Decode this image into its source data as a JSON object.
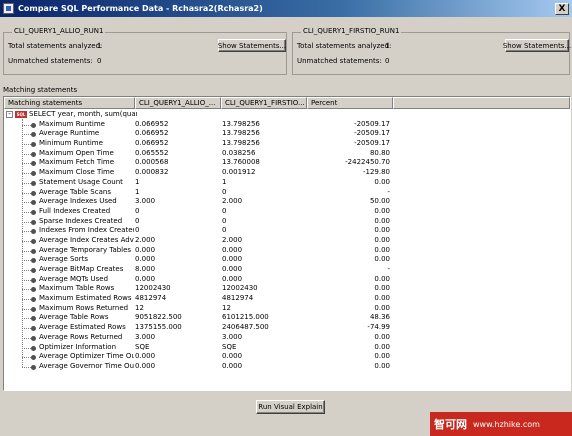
{
  "window": {
    "title": "Compare SQL Performance Data - Rchasra2(Rchasra2)",
    "close_glyph": "X"
  },
  "left_group": {
    "legend": "CLI_QUERY1_ALLIO_RUN1",
    "total_label": "Total statements analyzed:",
    "total_value": "1",
    "unmatched_label": "Unmatched statements:",
    "unmatched_value": "0",
    "button_label": "Show Statements..."
  },
  "right_group": {
    "legend": "CLI_QUERY1_FIRSTIO_RUN1",
    "total_label": "Total statements analyzed:",
    "total_value": "1",
    "unmatched_label": "Unmatched statements:",
    "unmatched_value": "0",
    "button_label": "Show Statements..."
  },
  "section_label": "Matching statements",
  "table": {
    "columns": [
      "Matching statements",
      "CLI_QUERY1_ALLIO_...",
      "CLI_QUERY1_FIRSTIO...",
      "Percent"
    ],
    "root": {
      "icon_text": "SQL",
      "expander": "-",
      "text": "SELECT year, month, sum(quantit"
    },
    "rows": [
      [
        "Maximum Runtime",
        "0.066952",
        "13.798256",
        "-20509.17"
      ],
      [
        "Average Runtime",
        "0.066952",
        "13.798256",
        "-20509.17"
      ],
      [
        "Minimum Runtime",
        "0.066952",
        "13.798256",
        "-20509.17"
      ],
      [
        "Maximum Open Time",
        "0.065552",
        "0.038256",
        "80.80"
      ],
      [
        "Maximum Fetch Time",
        "0.000568",
        "13.760008",
        "-2422450.70"
      ],
      [
        "Maximum Close Time",
        "0.000832",
        "0.001912",
        "-129.80"
      ],
      [
        "Statement Usage Count",
        "1",
        "1",
        "0.00"
      ],
      [
        "Average Table Scans",
        "1",
        "0",
        "-"
      ],
      [
        "Average Indexes Used",
        "3.000",
        "2.000",
        "50.00"
      ],
      [
        "Full Indexes Created",
        "0",
        "0",
        "0.00"
      ],
      [
        "Sparse Indexes Created",
        "0",
        "0",
        "0.00"
      ],
      [
        "Indexes From Index Created",
        "0",
        "0",
        "0.00"
      ],
      [
        "Average Index Creates Advised",
        "2.000",
        "2.000",
        "0.00"
      ],
      [
        "Average Temporary Tables",
        "0.000",
        "0.000",
        "0.00"
      ],
      [
        "Average Sorts",
        "0.000",
        "0.000",
        "0.00"
      ],
      [
        "Average BitMap Creates",
        "8.000",
        "0.000",
        "-"
      ],
      [
        "Average MQTs Used",
        "0.000",
        "0.000",
        "0.00"
      ],
      [
        "Maximum Table Rows",
        "12002430",
        "12002430",
        "0.00"
      ],
      [
        "Maximum Estimated Rows",
        "4812974",
        "4812974",
        "0.00"
      ],
      [
        "Maximum Rows Returned",
        "12",
        "12",
        "0.00"
      ],
      [
        "Average Table Rows",
        "9051822.500",
        "6101215.000",
        "48.36"
      ],
      [
        "Average Estimated Rows",
        "1375155.000",
        "2406487.500",
        "-74.99"
      ],
      [
        "Average Rows Returned",
        "3.000",
        "3.000",
        "0.00"
      ],
      [
        "Optimizer Information",
        "SQE",
        "SQE",
        "0.00"
      ],
      [
        "Average Optimizer Time Outs",
        "0.000",
        "0.000",
        "0.00"
      ],
      [
        "Average Governor Time Outs",
        "0.000",
        "0.000",
        "0.00"
      ]
    ]
  },
  "footer": {
    "button_label": "Run Visual Explain"
  },
  "watermark": {
    "main": "智可网",
    "url": "www.hzhike.com"
  },
  "colors": {
    "title_bar": "#0a246a",
    "window_bg": "#d4d0c8",
    "sql_icon": "#c03030",
    "watermark": "#c8281e"
  }
}
